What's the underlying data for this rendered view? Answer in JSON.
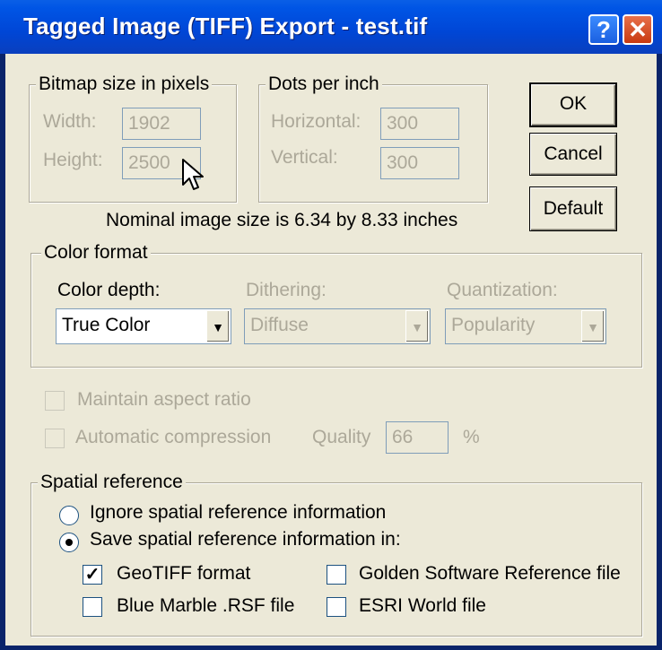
{
  "window": {
    "title": "Tagged Image (TIFF) Export - test.tif",
    "help_glyph": "?",
    "close_glyph": "✕"
  },
  "bitmap": {
    "legend": "Bitmap size in pixels",
    "width_label": "Width:",
    "width_value": "1902",
    "height_label": "Height:",
    "height_value": "2500"
  },
  "dpi": {
    "legend": "Dots per inch",
    "horizontal_label": "Horizontal:",
    "horizontal_value": "300",
    "vertical_label": "Vertical:",
    "vertical_value": "300"
  },
  "nominal_text": "Nominal image size is 6.34 by 8.33 inches",
  "buttons": {
    "ok": "OK",
    "cancel": "Cancel",
    "default": "Default"
  },
  "color_format": {
    "legend": "Color format",
    "depth_label": "Color depth:",
    "depth_value": "True Color",
    "dithering_label": "Dithering:",
    "dithering_value": "Diffuse",
    "quantization_label": "Quantization:",
    "quantization_value": "Popularity"
  },
  "options": {
    "maintain_aspect": "Maintain aspect ratio",
    "auto_compression": "Automatic compression",
    "quality_label": "Quality",
    "quality_value": "66",
    "percent": "%"
  },
  "spatial": {
    "legend": "Spatial reference",
    "ignore_label": "Ignore spatial reference information",
    "save_label": "Save spatial reference information in:",
    "geotiff": "GeoTIFF format",
    "blue_marble": "Blue Marble .RSF file",
    "golden": "Golden Software Reference file",
    "esri": "ESRI World file",
    "geotiff_checked": true
  },
  "glyphs": {
    "check": "✓",
    "dropdown": "▼"
  }
}
